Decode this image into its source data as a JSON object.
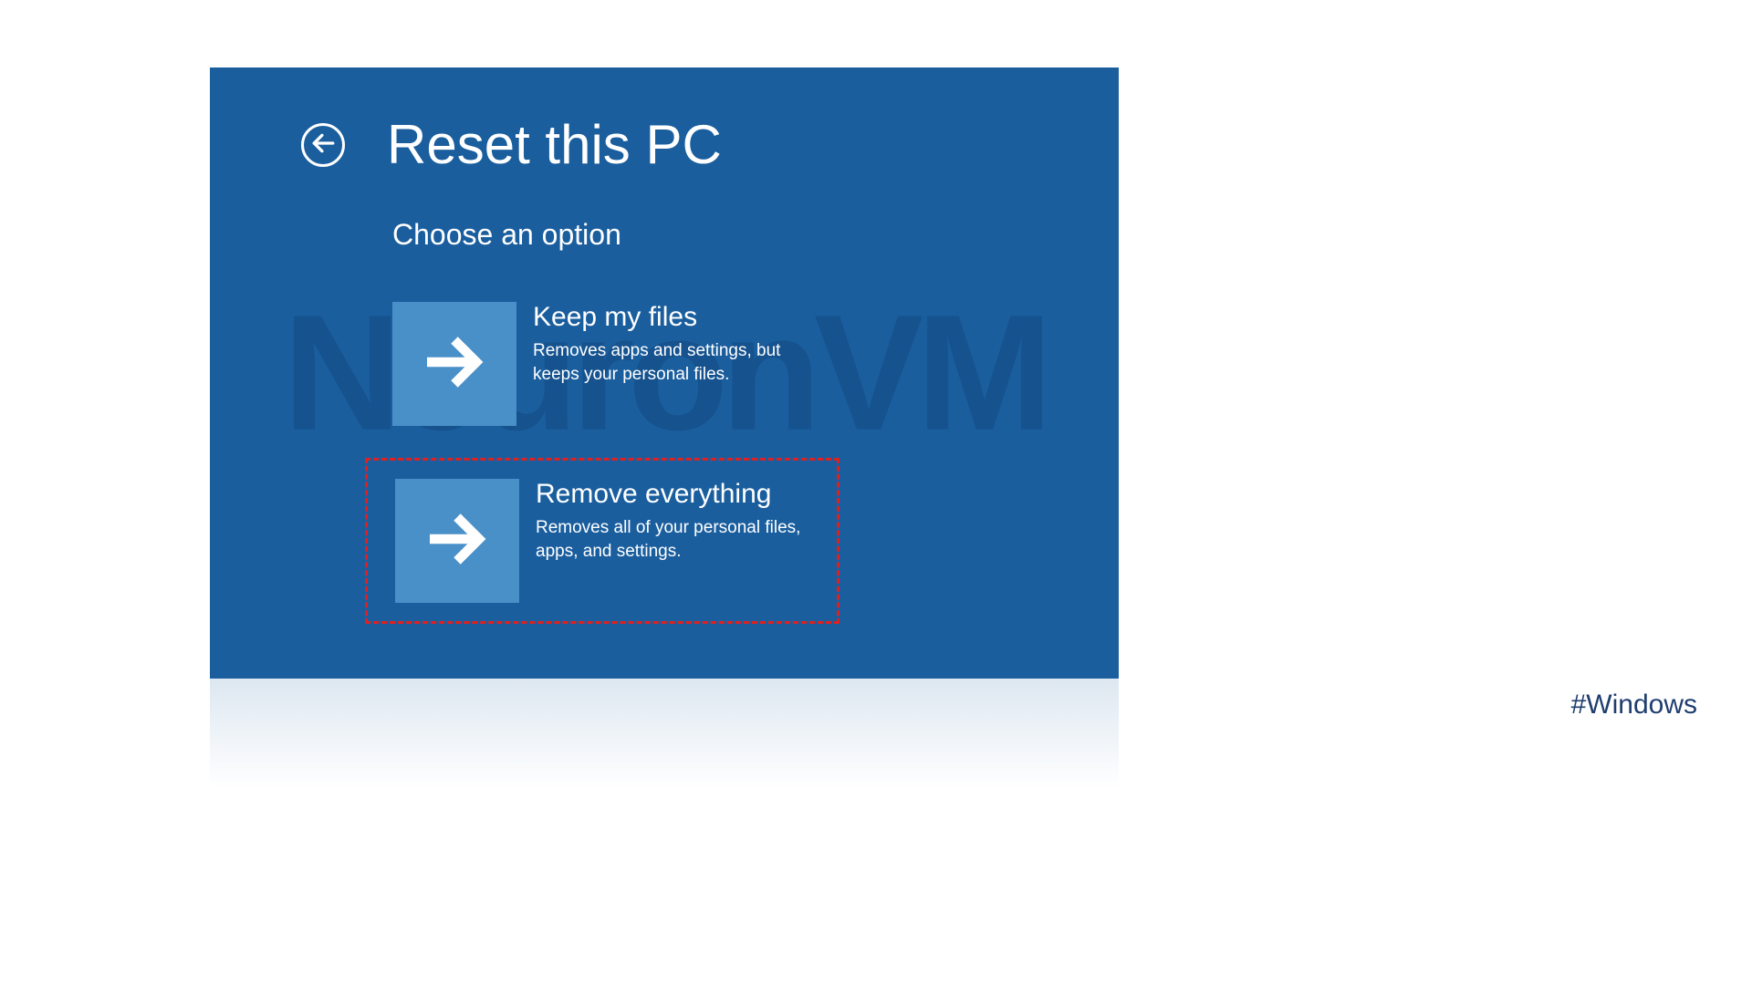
{
  "window": {
    "title": "Reset this PC",
    "subtitle": "Choose an option",
    "watermark": "NeuronVM"
  },
  "options": [
    {
      "title": "Keep my files",
      "description": "Removes apps and settings, but keeps your personal files.",
      "highlighted": false
    },
    {
      "title": "Remove everything",
      "description": "Removes all of your personal files, apps, and settings.",
      "highlighted": true
    }
  ],
  "hashtag": "#Windows"
}
